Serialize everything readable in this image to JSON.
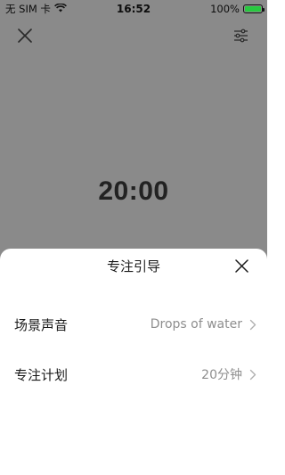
{
  "status_bar": {
    "carrier": "无 SIM 卡",
    "time": "16:52",
    "battery": "100%",
    "battery_level": 1.0
  },
  "timer": {
    "display": "20:00"
  },
  "sheet": {
    "title": "专注引导",
    "rows": [
      {
        "label": "场景声音",
        "value": "Drops of water"
      },
      {
        "label": "专注计划",
        "value": "20分钟"
      }
    ]
  },
  "icons": {
    "top_left": "close-icon",
    "top_right": "settings-sliders-icon",
    "sheet_close": "close-icon",
    "row_chevron": "chevron-right-icon"
  },
  "colors": {
    "overlay_background": "#8a8a8a",
    "sheet_background": "#ffffff",
    "secondary_text": "#8e8e8e",
    "battery_fill": "#28c940"
  }
}
